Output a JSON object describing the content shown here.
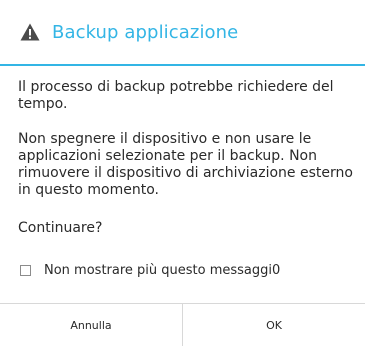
{
  "dialog": {
    "title": "Backup applicazione",
    "title_icon": "warning-icon",
    "accent_color": "#33b5e5",
    "paragraphs": [
      "Il processo di backup potrebbe richiedere del tempo.",
      "Non spegnere il dispositivo e non usare le applicazioni selezionate per il backup. Non rimuovere il dispositivo di archiviazione esterno in questo momento.",
      "Continuare?"
    ],
    "checkbox": {
      "label": "Non mostrare più questo messaggi0",
      "checked": false
    },
    "buttons": {
      "cancel_label": "Annulla",
      "ok_label": "OK"
    }
  }
}
